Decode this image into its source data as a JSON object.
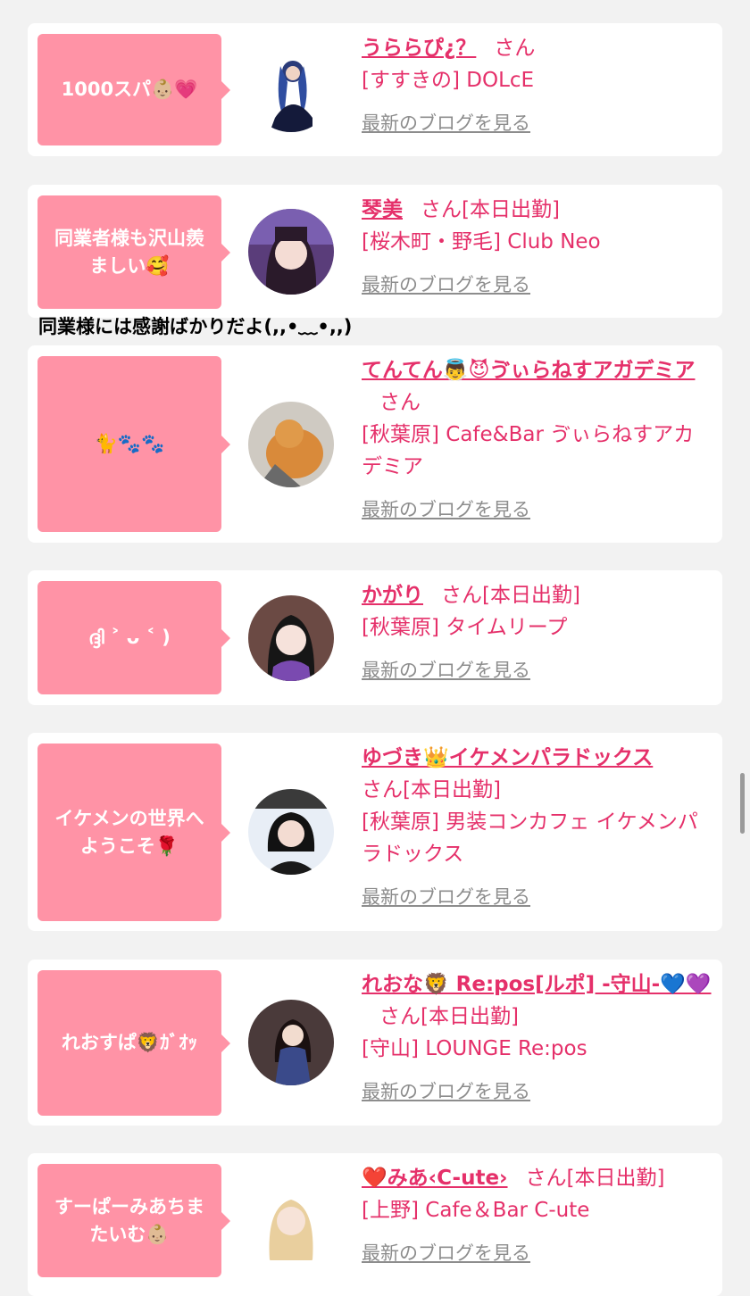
{
  "cards": [
    {
      "bubble": "1000スパ👶🏼💗",
      "name": "うららぴ¿？",
      "suffix": "さん",
      "shop": "[すすきの] DOLcE",
      "blog": "最新のブログを見る"
    },
    {
      "bubble": "同業者様も沢山羨\nましい🥰",
      "name": "琴美",
      "suffix": "さん[本日出勤]",
      "shop": "[桜木町・野毛] Club Neo",
      "blog": "最新のブログを見る"
    },
    {
      "bubble": "🐈🐾🐾",
      "name": "てんてん👼😈ゔぃらねすアガデミア",
      "suffix": "さん",
      "shop": "[秋葉原] Cafe&Bar ゔぃらねすアカデミア",
      "blog": "最新のブログを見る"
    },
    {
      "bubble": "ദ്ദി ˃ ᴗ ˂ )",
      "name": "かがり",
      "suffix": "さん[本日出勤]",
      "shop": "[秋葉原] タイムリープ",
      "blog": "最新のブログを見る"
    },
    {
      "bubble": "イケメンの世界へ\nようこそ🌹",
      "name": "ゆづき👑イケメンパラドックス",
      "suffix": "さん[本日出勤]",
      "shop": "[秋葉原] 男装コンカフェ イケメンパラドックス",
      "blog": "最新のブログを見る"
    },
    {
      "bubble": "れおすぱ🦁ｶﾞｵｯ",
      "name": "れおな🦁 Re:pos[ルポ] -守山-💙💜",
      "suffix": "さん[本日出勤]",
      "shop": "[守山] LOUNGE Re:pos",
      "blog": "最新のブログを見る"
    },
    {
      "bubble": "すーぱーみあちま\nたいむ👶🏼",
      "name": "❤️みあ‹C-ute›",
      "suffix": "さん[本日出勤]",
      "shop": "[上野] Cafe＆Bar C-ute",
      "blog": "最新のブログを見る"
    }
  ],
  "note": "同業様には感謝ばかりだよ(,,•﹏•,,)"
}
